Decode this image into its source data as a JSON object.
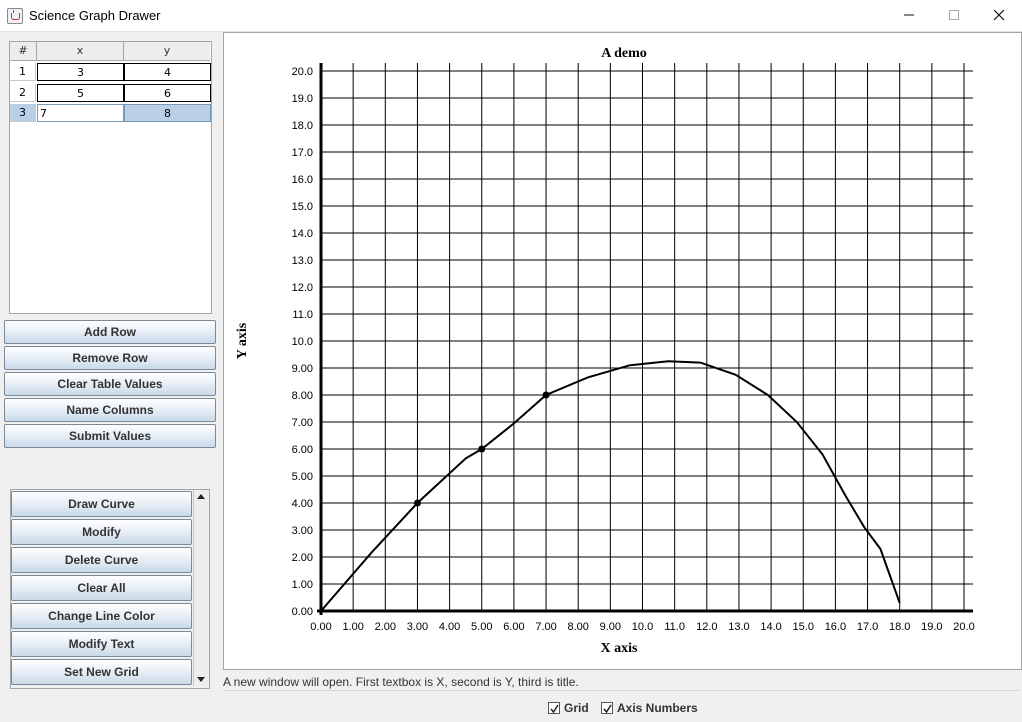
{
  "window": {
    "title": "Science Graph Drawer"
  },
  "table": {
    "headers": [
      "#",
      "x",
      "y"
    ],
    "rows": [
      {
        "n": "1",
        "x": "3",
        "y": "4"
      },
      {
        "n": "2",
        "x": "5",
        "y": "6"
      },
      {
        "n": "3",
        "x": "7",
        "y": "8"
      }
    ]
  },
  "table_buttons": [
    "Add Row",
    "Remove Row",
    "Clear Table Values",
    "Name Columns",
    "Submit Values"
  ],
  "curve_buttons": [
    "Draw Curve",
    "Modify",
    "Delete Curve",
    "Clear All",
    "Change Line Color",
    "Modify Text",
    "Set New Grid"
  ],
  "status_text": "A new window will open. First textbox is X, second is Y, third is title.",
  "options": {
    "grid_label": "Grid",
    "grid_checked": true,
    "axis_numbers_label": "Axis Numbers",
    "axis_numbers_checked": true
  },
  "chart_data": {
    "type": "line",
    "title": "A demo",
    "xlabel": "X axis",
    "ylabel": "Y axis",
    "xlim": [
      0,
      20
    ],
    "ylim": [
      0,
      20
    ],
    "grid": true,
    "x_tick_labels": [
      "0.00",
      "1.00",
      "2.00",
      "3.00",
      "4.00",
      "5.00",
      "6.00",
      "7.00",
      "8.00",
      "9.00",
      "10.0",
      "11.0",
      "12.0",
      "13.0",
      "14.0",
      "15.0",
      "16.0",
      "17.0",
      "18.0",
      "19.0",
      "20.0"
    ],
    "y_tick_labels": [
      "0.00",
      "1.00",
      "2.00",
      "3.00",
      "4.00",
      "5.00",
      "6.00",
      "7.00",
      "8.00",
      "9.00",
      "10.0",
      "11.0",
      "12.0",
      "13.0",
      "14.0",
      "15.0",
      "16.0",
      "17.0",
      "18.0",
      "19.0",
      "20.0"
    ],
    "points": [
      {
        "x": 3,
        "y": 4
      },
      {
        "x": 5,
        "y": 6
      },
      {
        "x": 7,
        "y": 8
      }
    ],
    "curve": {
      "x": [
        0,
        1.6,
        3,
        4.5,
        5,
        6,
        7,
        8.3,
        9.6,
        10.8,
        11.8,
        12.9,
        13.9,
        14.8,
        15.6,
        16.3,
        16.9,
        17.4,
        18
      ],
      "y": [
        0,
        2.2,
        4,
        5.65,
        6,
        6.95,
        8,
        8.65,
        9.1,
        9.25,
        9.2,
        8.75,
        8.0,
        7.0,
        5.8,
        4.3,
        3.1,
        2.3,
        0.3
      ]
    },
    "line_color": "#000000"
  }
}
